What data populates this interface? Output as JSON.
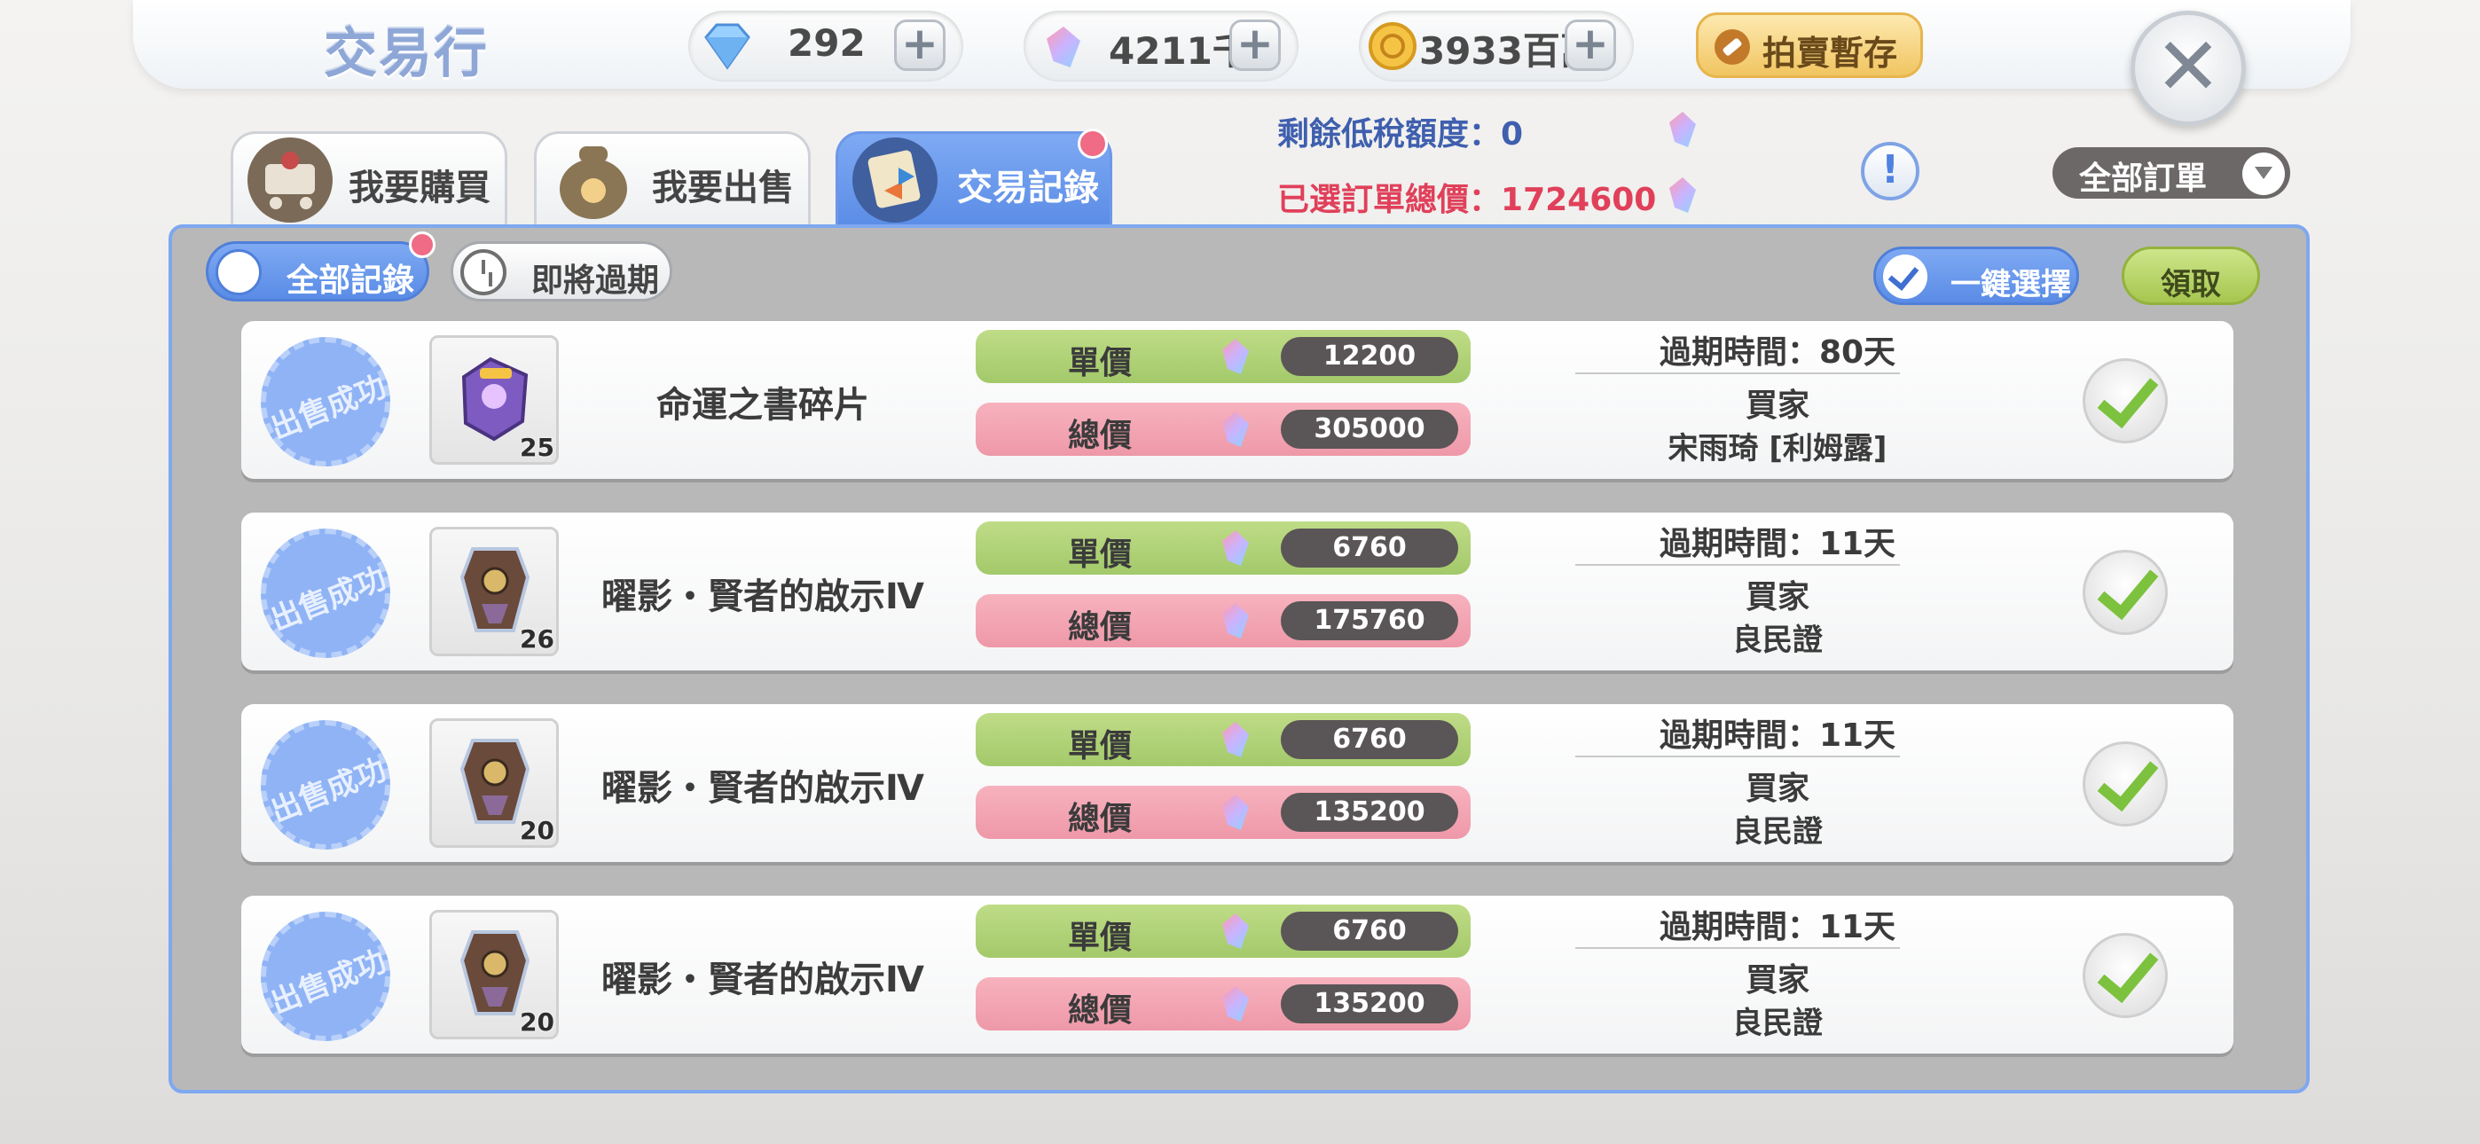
{
  "header": {
    "title": "交易行",
    "currencies": [
      {
        "icon": "diamond-icon",
        "value": "292"
      },
      {
        "icon": "crystal-icon",
        "value": "4211千"
      },
      {
        "icon": "zeny-coin-icon",
        "value": "3933百萬"
      }
    ],
    "plus_label": "+",
    "auction_storage_label": "拍賣暫存",
    "close_label": "✕"
  },
  "tabs": [
    {
      "label": "我要購買",
      "icon": "shopping-cart-icon",
      "active": false
    },
    {
      "label": "我要出售",
      "icon": "money-bag-icon",
      "active": false
    },
    {
      "label": "交易記錄",
      "icon": "trade-record-icon",
      "active": true
    }
  ],
  "summary": {
    "tax_quota_label": "剩餘低稅額度：",
    "tax_quota_value": "0",
    "selected_total_label": "已選訂單總價：",
    "selected_total_value": "1724600"
  },
  "help_label": "!",
  "order_filter": {
    "selected": "全部訂單"
  },
  "filters": {
    "all_records": "全部記錄",
    "expiring_soon": "即將過期",
    "select_all": "一鍵選擇",
    "claim": "領取"
  },
  "rows": [
    {
      "status": "出售成功",
      "item_name": "命運之書碎片",
      "qty": "25",
      "unit_label": "單價",
      "unit_price": "12200",
      "total_label": "總價",
      "total_price": "305000",
      "expiry": "過期時間：80天",
      "buyer_label": "買家",
      "buyer": "宋雨琦 [利姆露]"
    },
    {
      "status": "出售成功",
      "item_name": "曜影・賢者的啟示Ⅳ",
      "qty": "26",
      "unit_label": "單價",
      "unit_price": "6760",
      "total_label": "總價",
      "total_price": "175760",
      "expiry": "過期時間：11天",
      "buyer_label": "買家",
      "buyer": "良民證"
    },
    {
      "status": "出售成功",
      "item_name": "曜影・賢者的啟示Ⅳ",
      "qty": "20",
      "unit_label": "單價",
      "unit_price": "6760",
      "total_label": "總價",
      "total_price": "135200",
      "expiry": "過期時間：11天",
      "buyer_label": "買家",
      "buyer": "良民證"
    },
    {
      "status": "出售成功",
      "item_name": "曜影・賢者的啟示Ⅳ",
      "qty": "20",
      "unit_label": "單價",
      "unit_price": "6760",
      "total_label": "總價",
      "total_price": "135200",
      "expiry": "過期時間：11天",
      "buyer_label": "買家",
      "buyer": "良民證"
    }
  ],
  "colors": {
    "accent": "#5a8ce6",
    "unit_bar": "#a3c96a",
    "total_bar": "#ee98a8",
    "total_text": "#e0405a",
    "quota_text": "#3f5fae"
  }
}
